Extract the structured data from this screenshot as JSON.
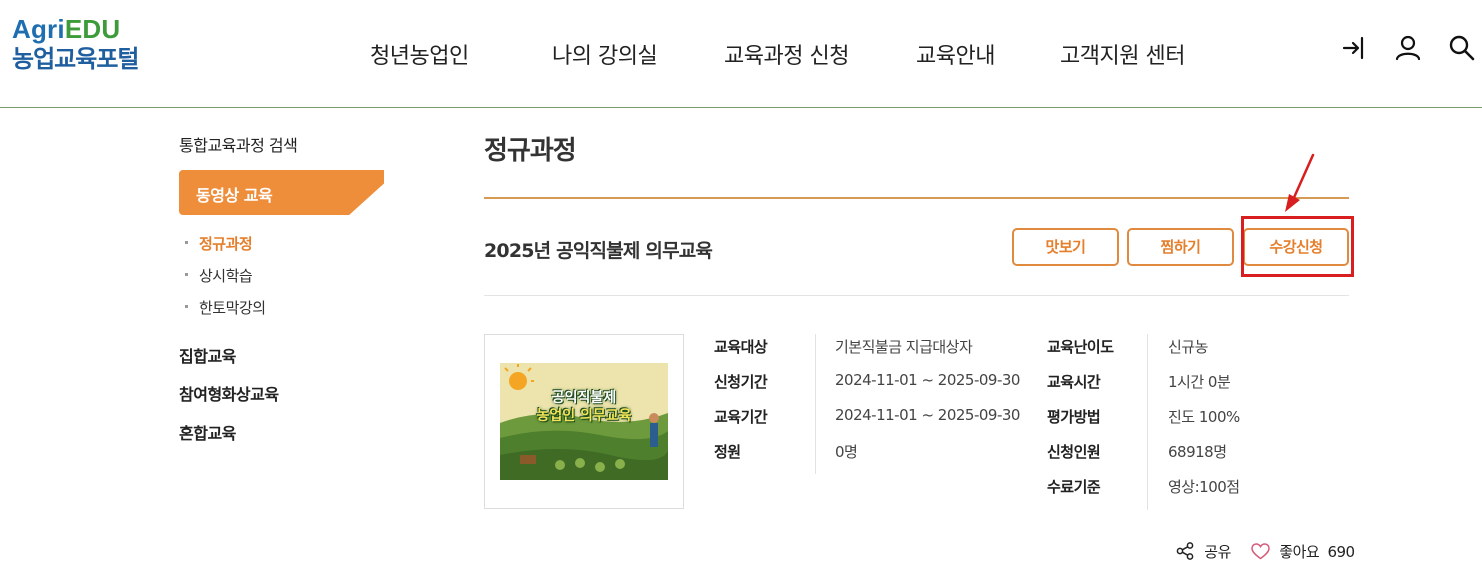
{
  "header": {
    "logo_agri": "Agri",
    "logo_edu": "EDU",
    "logo_subtitle": "농업교육포털",
    "nav": [
      "청년농업인",
      "나의 강의실",
      "교육과정 신청",
      "교육안내",
      "고객지원 센터"
    ],
    "icons": [
      "login-icon",
      "user-icon",
      "search-icon"
    ]
  },
  "sidebar": {
    "top_link": "통합교육과정 검색",
    "active_section": "동영상 교육",
    "sub_items": [
      "정규과정",
      "상시학습",
      "한토막강의"
    ],
    "active_sub": "정규과정",
    "categories": [
      "집합교육",
      "참여형화상교육",
      "혼합교육"
    ]
  },
  "main": {
    "page_title": "정규과정",
    "course_title": "2025년 공익직불제 의무교육",
    "buttons": {
      "preview": "맛보기",
      "wish": "찜하기",
      "enroll": "수강신청"
    },
    "thumbnail": {
      "line1": "공익직불제",
      "line2": "농업인 의무교육"
    },
    "info_left": [
      {
        "label": "교육대상",
        "value": "기본직불금 지급대상자"
      },
      {
        "label": "신청기간",
        "value": "2024-11-01 ~ 2025-09-30"
      },
      {
        "label": "교육기간",
        "value": "2024-11-01 ~ 2025-09-30"
      },
      {
        "label": "정원",
        "value": "0명"
      }
    ],
    "info_right": [
      {
        "label": "교육난이도",
        "value": "신규농"
      },
      {
        "label": "교육시간",
        "value": "1시간 0분"
      },
      {
        "label": "평가방법",
        "value": "진도 100%"
      },
      {
        "label": "신청인원",
        "value": "68918명"
      },
      {
        "label": "수료기준",
        "value": "영상:100점"
      }
    ],
    "share_label": "공유",
    "like_label": "좋아요",
    "like_count": "690"
  },
  "colors": {
    "accent": "#ee8d3a",
    "highlight": "#d81e1e",
    "logo_blue": "#1f6fb0",
    "logo_green": "#3e9b3a"
  }
}
